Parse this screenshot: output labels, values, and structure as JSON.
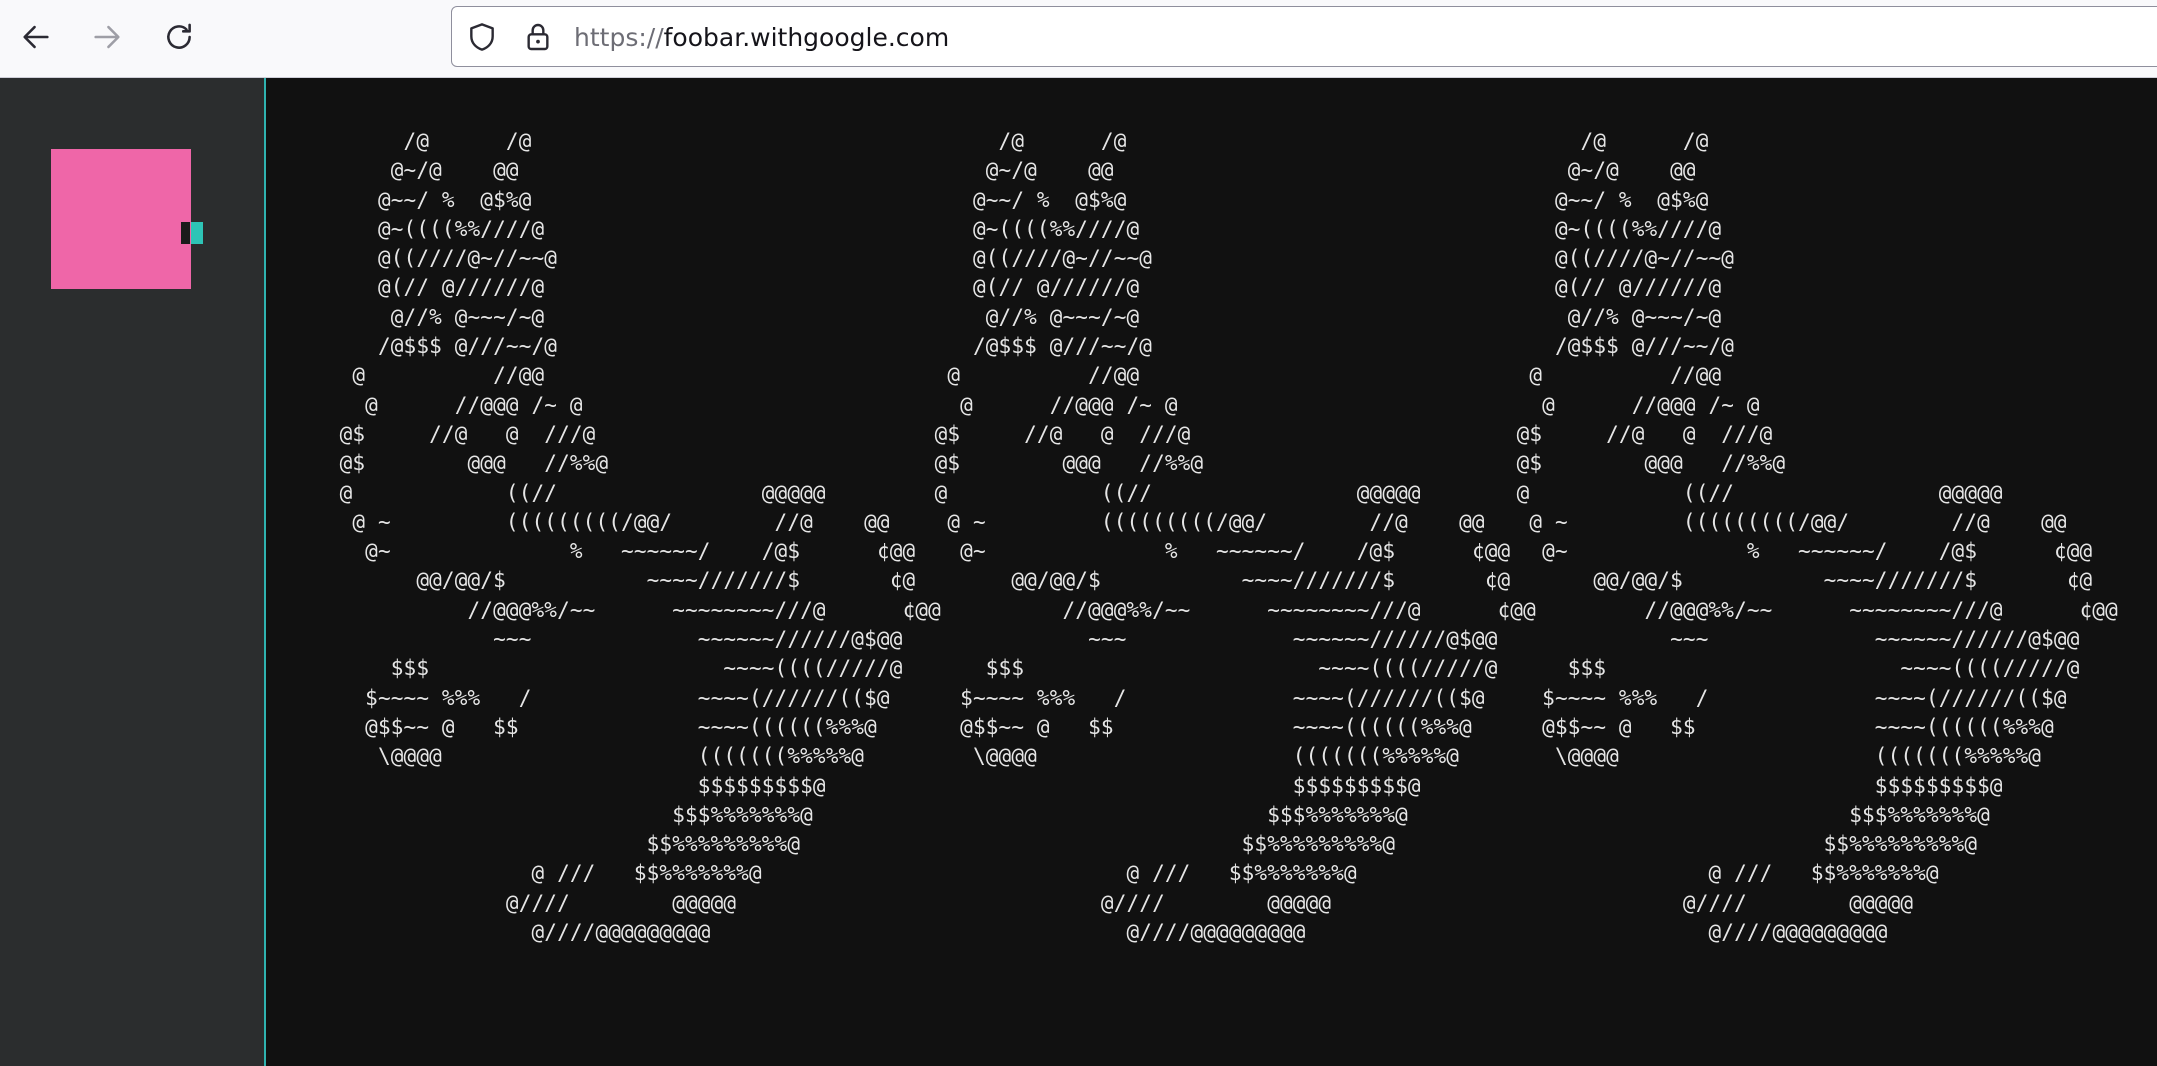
{
  "browser": {
    "back_icon": "arrow-left-icon",
    "forward_icon": "arrow-right-icon",
    "reload_icon": "reload-icon",
    "url_scheme": "https://",
    "url_host": "foobar.withgoogle.com"
  },
  "sidebar": {
    "avatar_color": "#ef66a8",
    "avatar_accent": "#2ec4b6"
  },
  "terminal": {
    "ascii_art": "       /@      /@\n      @~/@    @@\n     @~~/ %  @$%@\n     @~((((%%////@\n     @((////@~//~~@\n     @(// @//////@\n      @//% @~~~/~@\n     /@$$$ @///~~/@\n   @          //@@\n    @      //@@@ /~ @\n  @$     //@   @  ///@\n  @$        @@@   //%%@\n  @            ((//                @@@@@\n   @ ~         (((((((((/@@/        //@    @@\n    @~              %   ~~~~~~/    /@$      ¢@@\n        @@/@@/$           ~~~~///////$       ¢@\n            //@@@%%/~~      ~~~~~~~~///@      ¢@@\n              ~~~             ~~~~~~//////@$@@\n      $$$                       ~~~~((((/////@\n    $~~~~ %%%   /             ~~~~(//////(($@\n    @$$~~ @   $$              ~~~~((((((%%%@\n     \\@@@@                    (((((((%%%%%@\n                              $$$$$$$$$@\n                            $$$%%%%%%%@\n                          $$%%%%%%%%%@\n                 @ ///   $$%%%%%%%@\n               @////        @@@@@\n                 @////@@@@@@@@@"
  }
}
